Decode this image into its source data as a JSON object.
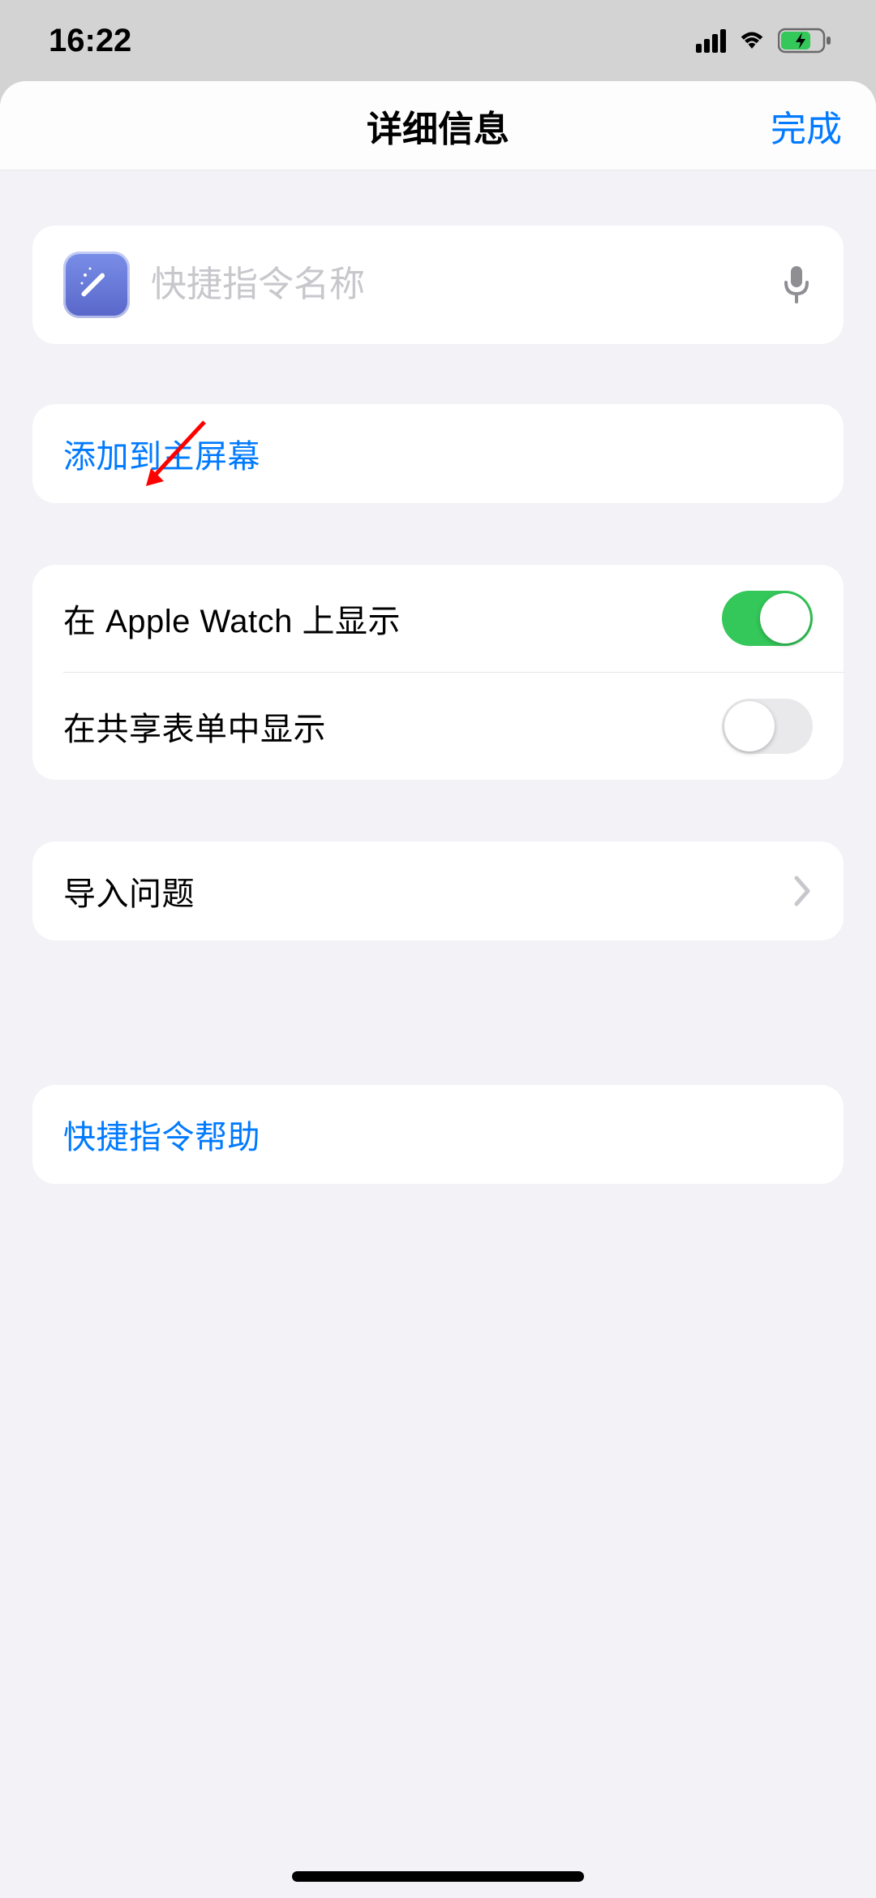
{
  "statusBar": {
    "time": "16:22"
  },
  "nav": {
    "title": "详细信息",
    "done": "完成"
  },
  "shortcut": {
    "namePlaceholder": "快捷指令名称",
    "nameValue": ""
  },
  "actions": {
    "addToHomeScreen": "添加到主屏幕"
  },
  "toggles": {
    "appleWatch": {
      "label": "在 Apple Watch 上显示",
      "on": true
    },
    "shareSheet": {
      "label": "在共享表单中显示",
      "on": false
    }
  },
  "importQuestions": "导入问题",
  "help": "快捷指令帮助"
}
